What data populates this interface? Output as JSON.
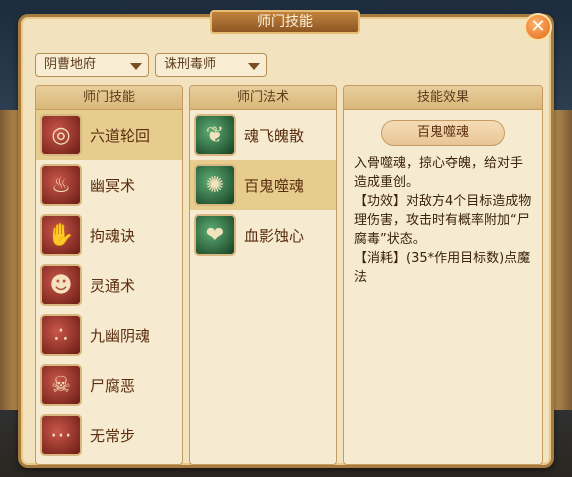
{
  "window": {
    "title": "师门技能"
  },
  "filters": {
    "sect": "阴曹地府",
    "role": "诛刑毒师"
  },
  "skills_column": {
    "header": "师门技能",
    "items": [
      {
        "label": "六道轮回",
        "icon": "wheel-icon",
        "selected": true
      },
      {
        "label": "幽冥术",
        "icon": "ghost-icon",
        "selected": false
      },
      {
        "label": "拘魂诀",
        "icon": "chain-hand-icon",
        "selected": false
      },
      {
        "label": "灵通术",
        "icon": "spirit-face-icon",
        "selected": false
      },
      {
        "label": "九幽阴魂",
        "icon": "three-souls-icon",
        "selected": false
      },
      {
        "label": "尸腐恶",
        "icon": "skull-icon",
        "selected": false
      },
      {
        "label": "无常步",
        "icon": "footstep-icon",
        "selected": false
      }
    ]
  },
  "spells_column": {
    "header": "师门法术",
    "items": [
      {
        "label": "魂飞魄散",
        "icon": "flying-souls-icon",
        "selected": false
      },
      {
        "label": "百鬼噬魂",
        "icon": "swirl-ghosts-icon",
        "selected": true
      },
      {
        "label": "血影蚀心",
        "icon": "blood-heart-icon",
        "selected": false
      }
    ]
  },
  "effect_column": {
    "header": "技能效果",
    "skill_name": "百鬼噬魂",
    "description": "入骨噬魂，掠心夺魄，给对手造成重创。\n【功效】对敌方4个目标造成物理伤害，攻击时有概率附加“尸腐毒”状态。\n【消耗】(35*作用目标数)点魔法"
  },
  "colors": {
    "panel_bg": "#f3e2be",
    "border": "#a67b3d",
    "selected_row": "#e6cd8e",
    "skill_icon": "#8a2a20",
    "spell_icon": "#2e6a3a",
    "close_button": "#e06a18"
  }
}
